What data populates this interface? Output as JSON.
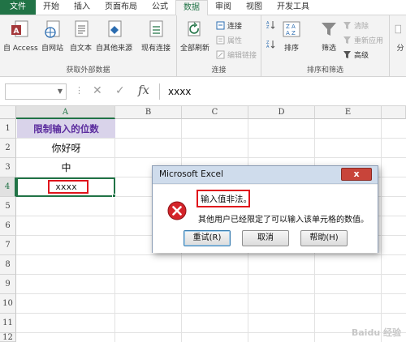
{
  "tabs": [
    {
      "label": "文件",
      "kind": "file"
    },
    {
      "label": "开始"
    },
    {
      "label": "插入"
    },
    {
      "label": "页面布局"
    },
    {
      "label": "公式"
    },
    {
      "label": "数据",
      "active": true
    },
    {
      "label": "审阅"
    },
    {
      "label": "视图"
    },
    {
      "label": "开发工具"
    }
  ],
  "ribbon": {
    "external": {
      "group_label": "获取外部数据",
      "access": "自 Access",
      "web": "自网站",
      "text": "自文本",
      "other": "自其他来源",
      "existing": "现有连接"
    },
    "connections": {
      "group_label": "连接",
      "refresh_all": "全部刷新",
      "connections": "连接",
      "properties": "属性",
      "edit_links": "编辑链接"
    },
    "sort_filter": {
      "group_label": "排序和筛选",
      "sort": "排序",
      "filter": "筛选",
      "clear": "清除",
      "reapply": "重新应用",
      "advanced": "高级"
    },
    "overflow": "分"
  },
  "formula_bar": {
    "name_box": "",
    "fx": "fx",
    "content": "xxxx"
  },
  "grid": {
    "columns": [
      "A",
      "B",
      "C",
      "D",
      "E"
    ],
    "rows": [
      "1",
      "2",
      "3",
      "4",
      "5",
      "6",
      "7",
      "8",
      "9",
      "10",
      "11",
      "12"
    ],
    "cells": {
      "a1": "限制输入的位数",
      "a2": "你好呀",
      "a3": "中",
      "a4": "xxxx"
    }
  },
  "dialog": {
    "title": "Microsoft Excel",
    "close": "x",
    "message": "输入值非法。",
    "detail": "其他用户已经限定了可以输入该单元格的数值。",
    "retry": "重试(R)",
    "cancel": "取消",
    "help": "帮助(H)"
  },
  "watermark": "Baidu 经验",
  "colors": {
    "excel_green": "#217346",
    "header_fill": "#d9d3ea",
    "header_text": "#5b2c9e",
    "highlight_red": "#e0141c"
  }
}
